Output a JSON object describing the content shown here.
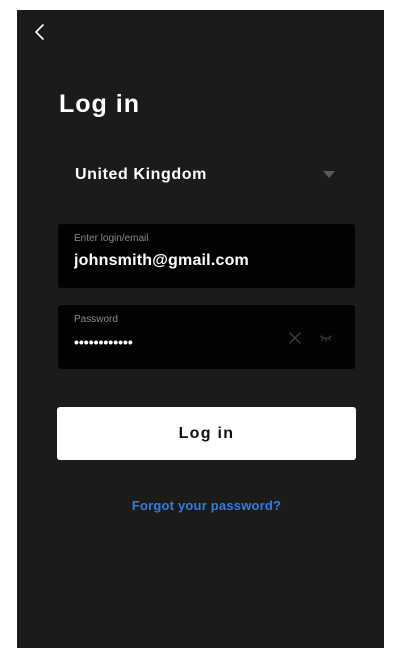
{
  "header": {
    "back_icon": "chevron-left-icon",
    "title": "Log in"
  },
  "country": {
    "selected": "United Kingdom",
    "icon": "caret-down-icon"
  },
  "email_field": {
    "caption": "Enter login/email",
    "value": "johnsmith@gmail.com"
  },
  "password_field": {
    "caption": "Password",
    "value": "secretpass12",
    "clear_icon": "close-icon",
    "visibility_icon": "eye-closed-icon"
  },
  "login_button": {
    "label": "Log in"
  },
  "forgot_link": {
    "label": "Forgot your password?"
  },
  "colors": {
    "background": "#1b1b1b",
    "field_background": "#030303",
    "button_background": "#ffffff",
    "link": "#2f7ee6",
    "caption": "#8a8a8a"
  }
}
